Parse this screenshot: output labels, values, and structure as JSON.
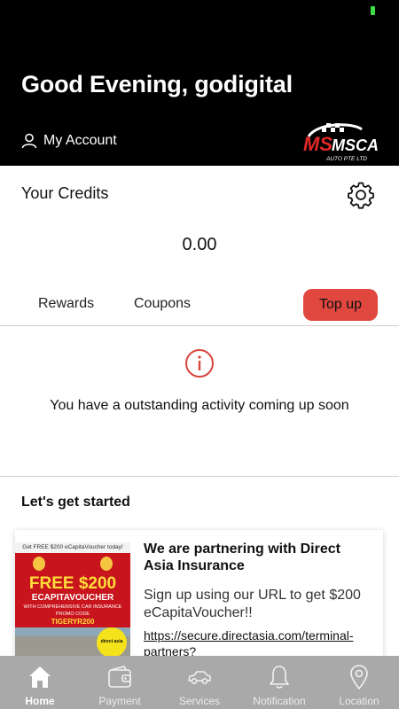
{
  "header": {
    "greeting": "Good Evening, godigital",
    "account_label": "My Account",
    "logo_text": "MSCAR",
    "logo_subtext": "AUTO PTE LTD"
  },
  "credits": {
    "title": "Your Credits",
    "balance": "0.00",
    "tabs": [
      "Rewards",
      "Coupons"
    ],
    "topup_label": "Top up"
  },
  "activity": {
    "message": "You have a outstanding activity coming up soon"
  },
  "get_started": {
    "title": "Let's get started",
    "card": {
      "image": {
        "top_text": "Get FREE $200 eCapitaVoucher today!",
        "free_text": "FREE $200",
        "voucher_text": "ECAPITAVOUCHER",
        "sub_text": "WITH COMPREHENSIVE CAR INSURANCE",
        "promo_label": "PROMO CODE",
        "promo_code": "TIGERYR200",
        "badge_text": "direct asia"
      },
      "title": "We are partnering with Direct Asia Insurance",
      "description": "Sign up using our URL to get $200 eCapitaVoucher!!",
      "link": "https://secure.directasia.com/terminal-partners?"
    }
  },
  "colors": {
    "accent": "#e0473f",
    "header_bg": "#000000",
    "nav_bg": "#a9a9a9"
  },
  "nav": {
    "items": [
      {
        "label": "Home",
        "icon": "home-icon"
      },
      {
        "label": "Payment",
        "icon": "wallet-icon"
      },
      {
        "label": "Services",
        "icon": "car-icon"
      },
      {
        "label": "Notification",
        "icon": "bell-icon"
      },
      {
        "label": "Location",
        "icon": "location-pin-icon"
      }
    ]
  }
}
